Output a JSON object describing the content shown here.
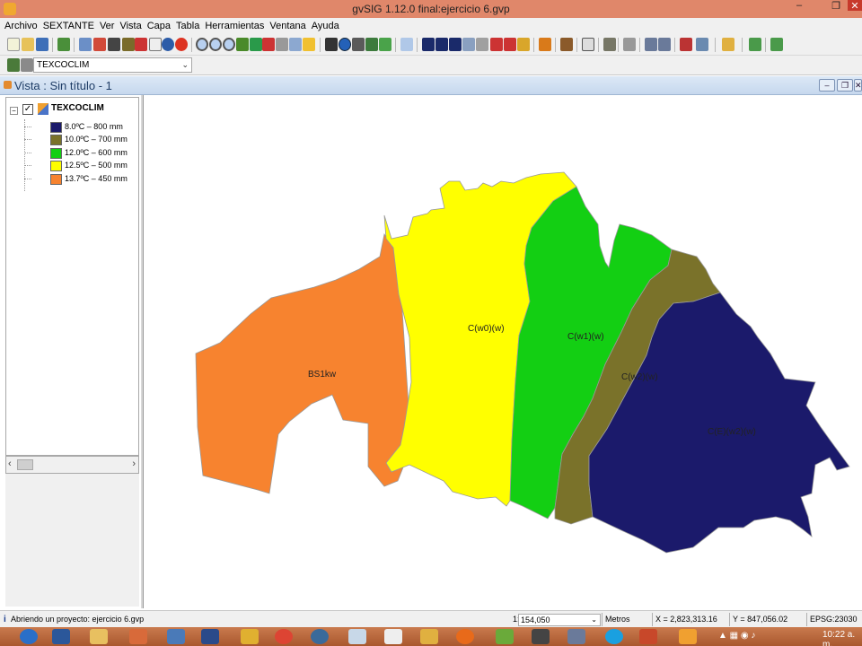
{
  "window": {
    "title": "gvSIG 1.12.0 final:ejercicio 6.gvp",
    "min_symbol": "–",
    "max_symbol": "❐",
    "close_symbol": "✕"
  },
  "menu": [
    "Archivo",
    "SEXTANTE",
    "Ver",
    "Vista",
    "Capa",
    "Tabla",
    "Herramientas",
    "Ventana",
    "Ayuda"
  ],
  "toolbar": {
    "active_layer": "TEXCOCLIM",
    "select_arrow": "⌄"
  },
  "view": {
    "title": "Vista : Sin título - 1",
    "min_symbol": "–",
    "max_symbol": "❐",
    "close_symbol": "✕"
  },
  "toc": {
    "expander": "−",
    "check": "✓",
    "layer_name": "TEXCOCLIM",
    "legend": [
      {
        "label": "8.0ºC – 800 mm",
        "color": "#1b1a6b"
      },
      {
        "label": "10.0ºC – 700 mm",
        "color": "#7a722a"
      },
      {
        "label": "12.0ºC – 600 mm",
        "color": "#13cf13"
      },
      {
        "label": "12.5ºC – 500 mm",
        "color": "#ffff00"
      },
      {
        "label": "13.7ºC – 450 mm",
        "color": "#f7832f"
      }
    ],
    "scroll_left": "‹",
    "scroll_right": "›"
  },
  "map": {
    "zones": [
      {
        "label": "BS1kw",
        "color": "#f7832f"
      },
      {
        "label": "C(w0)(w)",
        "color": "#ffff00"
      },
      {
        "label": "C(w1)(w)",
        "color": "#13cf13"
      },
      {
        "label": "C(w2)(w)",
        "color": "#7a722a"
      },
      {
        "label": "C(E)(w2)(w)",
        "color": "#1b1a6b"
      }
    ]
  },
  "status": {
    "info_icon": "i",
    "message": "Abriendo un proyecto: ejercicio 6.gvp",
    "scale_prefix": "1:",
    "scale": "154,050",
    "scale_arrow": "⌄",
    "units": "Metros",
    "x": "X = 2,823,313.16",
    "y": "Y = 847,056.02",
    "epsg": "EPSG:23030"
  },
  "taskbar": {
    "clock": "10:22 a. m.",
    "tray": "▲ ▦ ◉ ♪"
  }
}
